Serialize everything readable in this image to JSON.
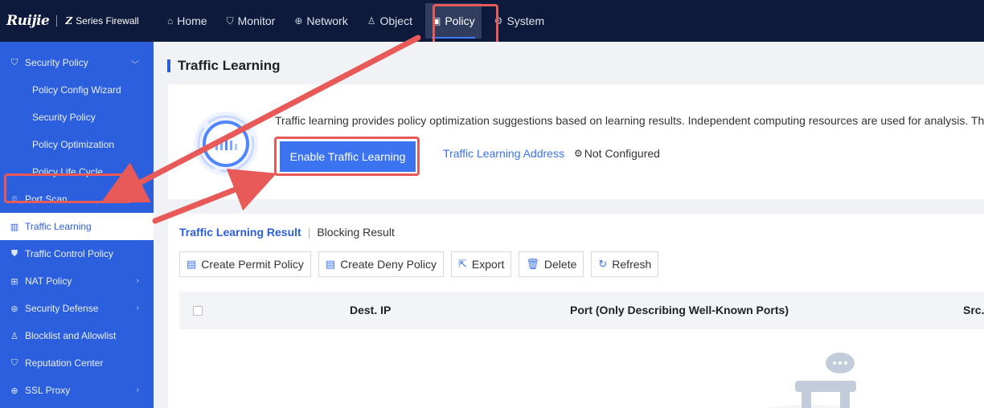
{
  "brand": {
    "logo": "Ruijie",
    "product": "Series Firewall",
    "product_prefix": "Z"
  },
  "nav": {
    "items": [
      {
        "label": "Home",
        "icon": "home-icon"
      },
      {
        "label": "Monitor",
        "icon": "shield-icon"
      },
      {
        "label": "Network",
        "icon": "globe-icon"
      },
      {
        "label": "Object",
        "icon": "user-icon"
      },
      {
        "label": "Policy",
        "icon": "policy-icon",
        "active": true
      },
      {
        "label": "System",
        "icon": "gear-icon"
      }
    ]
  },
  "sidebar": {
    "items": [
      {
        "label": "Security Policy",
        "icon": "shield-icon",
        "expanded": true
      },
      {
        "label": "Policy Config Wizard"
      },
      {
        "label": "Security Policy"
      },
      {
        "label": "Policy Optimization"
      },
      {
        "label": "Policy Life Cycle"
      },
      {
        "label": "Port Scan",
        "icon": "scan-icon"
      },
      {
        "label": "Traffic Learning",
        "icon": "chart-icon",
        "active": true
      },
      {
        "label": "Traffic Control Policy",
        "icon": "traffic-icon"
      },
      {
        "label": "NAT Policy",
        "icon": "nat-icon"
      },
      {
        "label": "Security Defense",
        "icon": "defense-icon"
      },
      {
        "label": "Blocklist and Allowlist",
        "icon": "user-list-icon"
      },
      {
        "label": "Reputation Center",
        "icon": "reputation-icon"
      },
      {
        "label": "SSL Proxy",
        "icon": "ssl-icon"
      }
    ]
  },
  "page": {
    "title": "Traffic Learning",
    "intro": "Traffic learning provides policy optimization suggestions based on learning results. Independent computing resources are used for analysis. Therefore",
    "enable_button": "Enable Traffic Learning",
    "address_link": "Traffic Learning Address",
    "address_status": "Not Configured"
  },
  "results": {
    "tabs": [
      {
        "label": "Traffic Learning Result",
        "active": true
      },
      {
        "label": "Blocking Result"
      }
    ],
    "toolbar": {
      "create_permit": "Create Permit Policy",
      "create_deny": "Create Deny Policy",
      "export": "Export",
      "delete": "Delete",
      "refresh": "Refresh"
    },
    "columns": [
      "Dest. IP",
      "Port (Only Describing Well-Known Ports)",
      "Src."
    ]
  },
  "colors": {
    "accent": "#3b73f0",
    "sidebar": "#2c5fde",
    "topbar": "#0d1a3b",
    "highlight": "#e85a58"
  }
}
